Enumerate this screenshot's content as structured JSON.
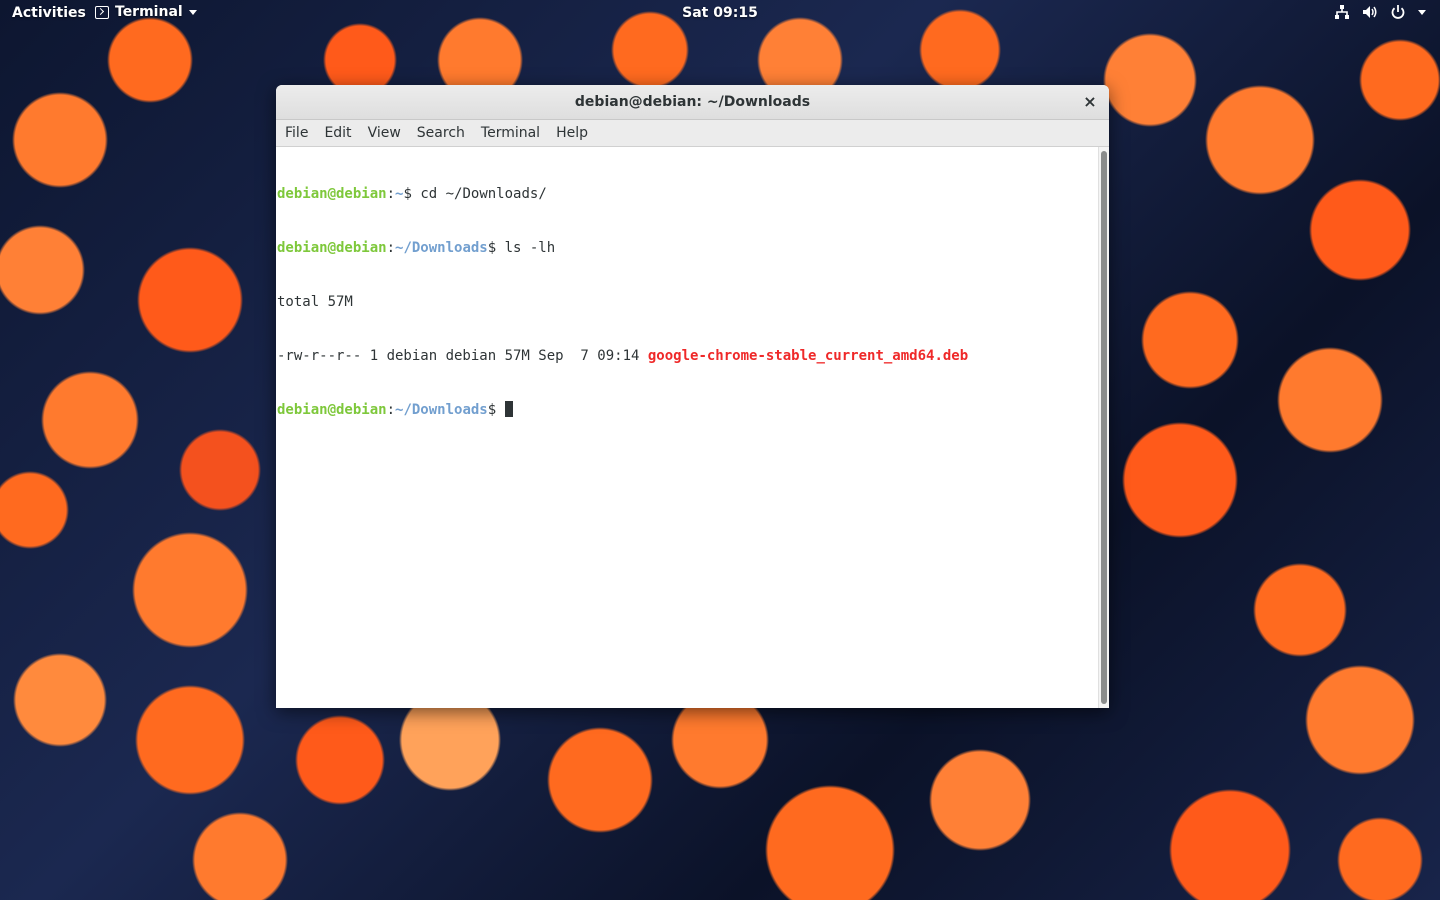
{
  "topbar": {
    "activities": "Activities",
    "app_name": "Terminal",
    "clock": "Sat 09:15"
  },
  "window": {
    "title": "debian@debian: ~/Downloads",
    "close_glyph": "×"
  },
  "menubar": {
    "items": [
      "File",
      "Edit",
      "View",
      "Search",
      "Terminal",
      "Help"
    ]
  },
  "terminal": {
    "lines": [
      {
        "user": "debian@debian",
        "sep": ":",
        "path": "~",
        "prompt": "$ ",
        "command": "cd ~/Downloads/"
      },
      {
        "user": "debian@debian",
        "sep": ":",
        "path": "~/Downloads",
        "prompt": "$ ",
        "command": "ls -lh"
      },
      {
        "output": "total 57M"
      },
      {
        "output": "-rw-r--r-- 1 debian debian 57M Sep  7 09:14 ",
        "filename": "google-chrome-stable_current_amd64.deb"
      },
      {
        "user": "debian@debian",
        "sep": ":",
        "path": "~/Downloads",
        "prompt": "$ ",
        "command": ""
      }
    ]
  },
  "colors": {
    "user": "#7ec83b",
    "path": "#729fcf",
    "deb_file": "#ef2929",
    "terminal_bg": "#ffffff",
    "terminal_fg": "#2e3436"
  },
  "icons": [
    "terminal-app-icon",
    "network-icon",
    "volume-icon",
    "power-icon",
    "chevron-down-icon",
    "close-icon"
  ]
}
